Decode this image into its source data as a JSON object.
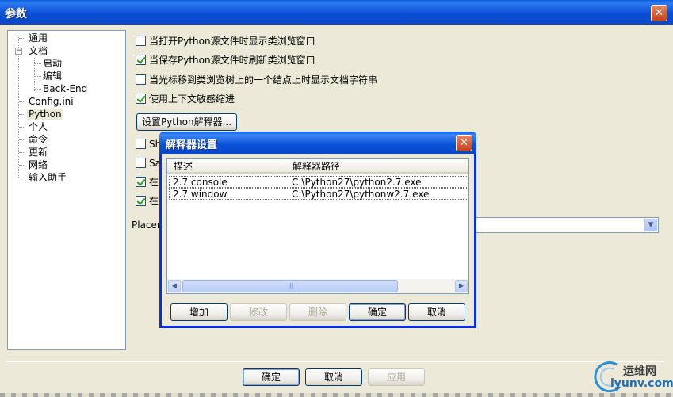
{
  "window": {
    "title": "参数",
    "close_glyph": "✕"
  },
  "tree": {
    "items": [
      {
        "label": "通用"
      },
      {
        "label": "文档",
        "expander": "−"
      },
      {
        "label": "启动"
      },
      {
        "label": "编辑"
      },
      {
        "label": "Back-End"
      },
      {
        "label": "Config.ini"
      },
      {
        "label": "Python"
      },
      {
        "label": "个人"
      },
      {
        "label": "命令"
      },
      {
        "label": "更新"
      },
      {
        "label": "网络"
      },
      {
        "label": "输入助手"
      }
    ]
  },
  "options": {
    "checkboxes": [
      {
        "label": "当打开Python源文件时显示类浏览窗口",
        "checked": false
      },
      {
        "label": "当保存Python源文件时刷新类浏览窗口",
        "checked": true
      },
      {
        "label": "当光标移到类浏览树上的一个结点上时显示文档字符串",
        "checked": false
      },
      {
        "label": "使用上下文敏感缩进",
        "checked": true
      },
      {
        "label": "Sh",
        "checked": false
      },
      {
        "label": "Sav",
        "checked": false
      },
      {
        "label": "在(",
        "checked": true
      },
      {
        "label": "在F",
        "checked": true
      }
    ],
    "set_interpreter_button": "设置Python解释器...",
    "placement_label": "Placem",
    "placement_value": ""
  },
  "interpreter_dialog": {
    "title": "解释器设置",
    "columns": [
      "描述",
      "解释器路径"
    ],
    "rows": [
      {
        "desc": "2.7 console",
        "path": "C:\\Python27\\python2.7.exe"
      },
      {
        "desc": "2.7 window",
        "path": "C:\\Python27\\pythonw2.7.exe"
      }
    ],
    "buttons": {
      "add": "增加",
      "modify": "修改",
      "delete": "删除",
      "ok": "确定",
      "cancel": "取消"
    }
  },
  "footer": {
    "ok": "确定",
    "cancel": "取消",
    "apply": "应用"
  },
  "watermark": {
    "brand": "运维网",
    "site": "iyunv.com"
  }
}
